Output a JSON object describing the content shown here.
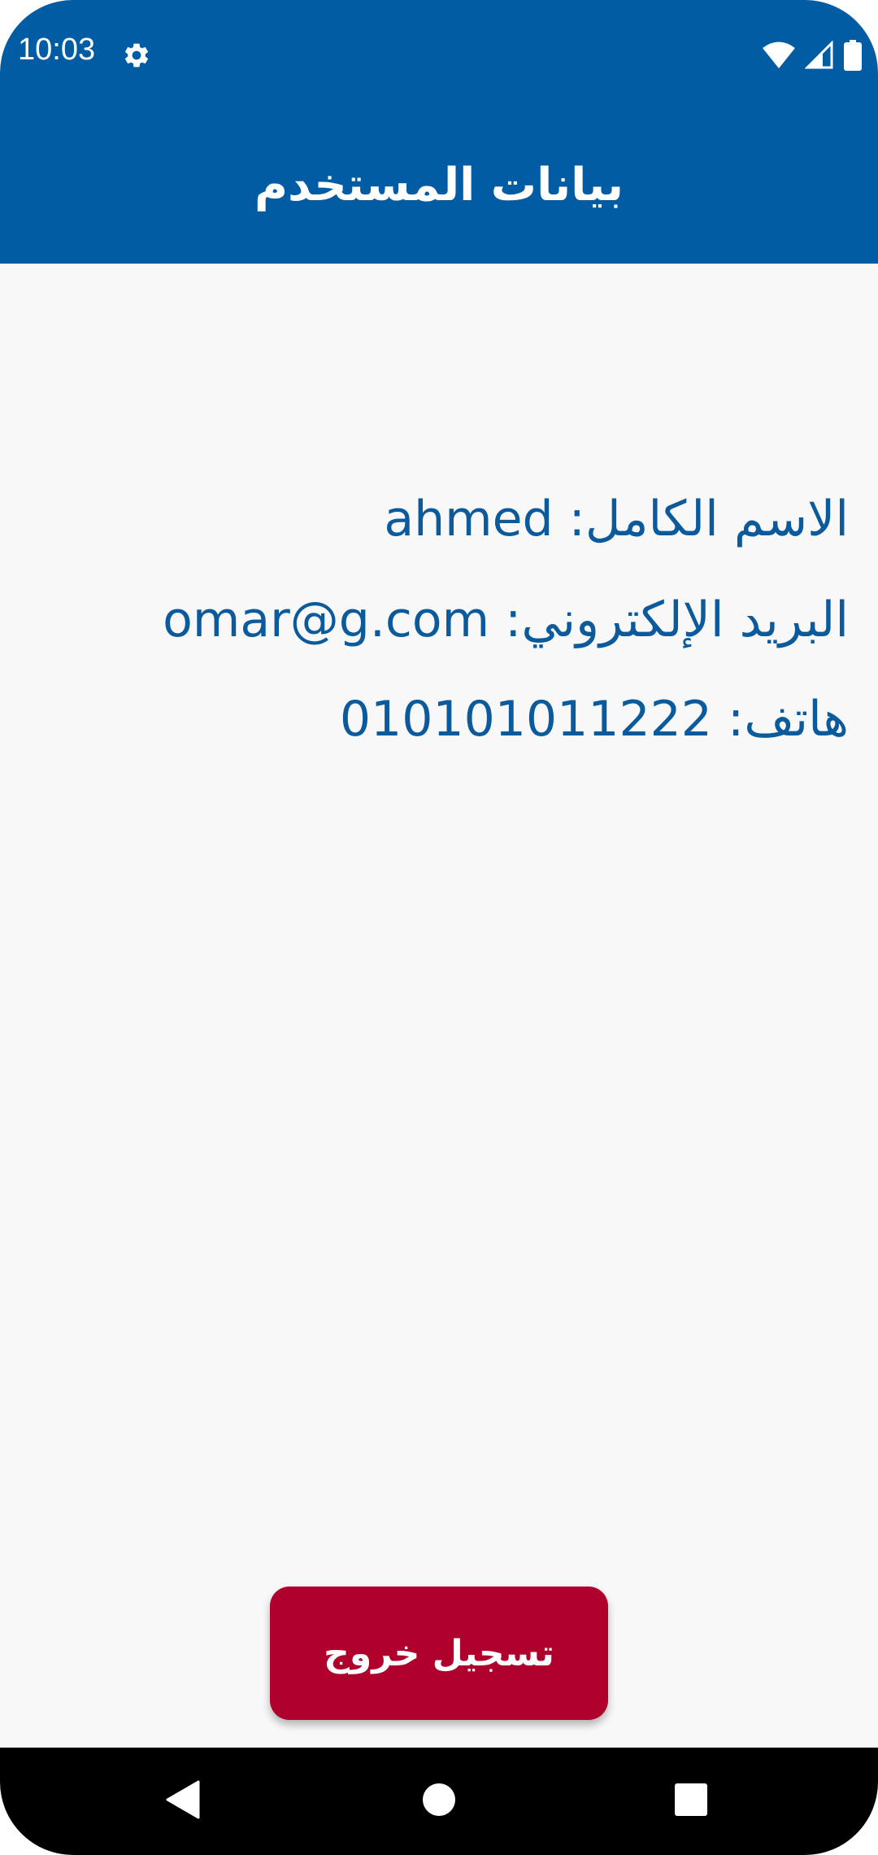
{
  "status_bar": {
    "time": "10:03",
    "icons": [
      "gear-icon",
      "wifi-icon",
      "cell-signal-icon",
      "battery-icon"
    ]
  },
  "app_bar": {
    "title": "بيانات المستخدم"
  },
  "user_info": {
    "full_name_label": "الاسم الكامل:",
    "full_name_value": "ahmed",
    "email_label": "البريد الإلكتروني:",
    "email_value": "omar@g.com",
    "phone_label": "هاتف:",
    "phone_value": "010101011222"
  },
  "actions": {
    "logout_label": "تسجيل خروج"
  },
  "nav_bar": {
    "icons": [
      "back-icon",
      "home-icon",
      "recents-icon"
    ]
  },
  "colors": {
    "primary": "#015ca4",
    "text_primary": "#0b5a9c",
    "logout_button": "#b0002c",
    "background": "#f8f8f8",
    "nav_bar": "#000000"
  }
}
